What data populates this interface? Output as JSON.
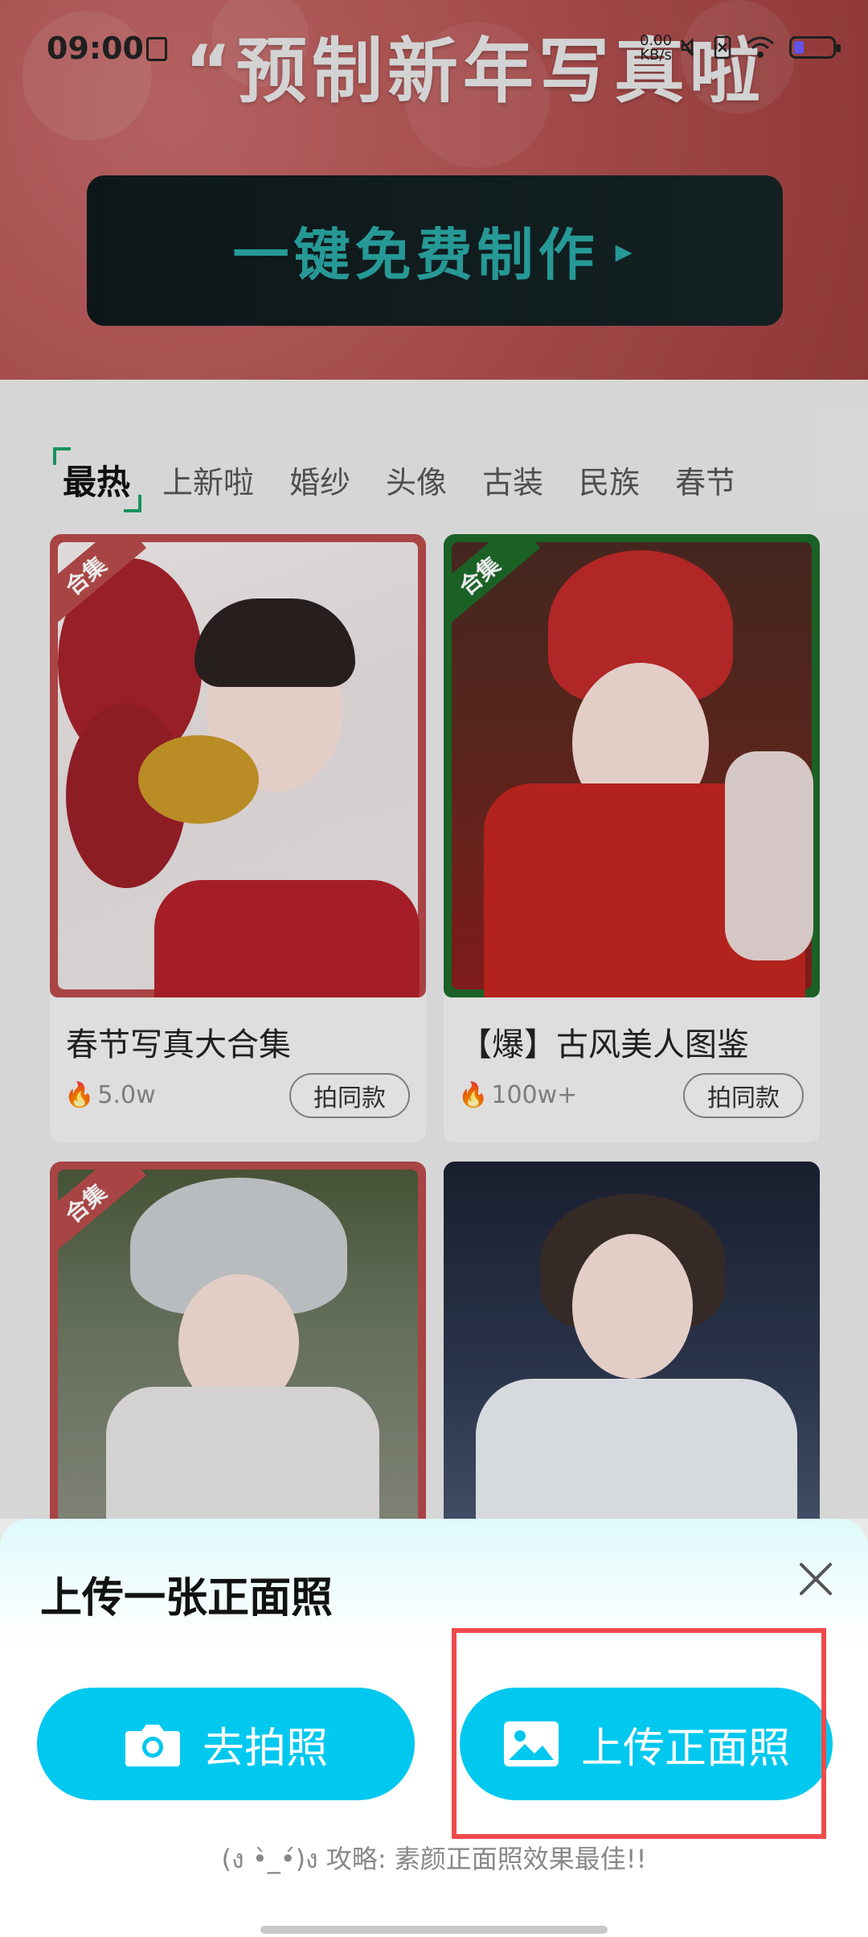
{
  "status_bar": {
    "time": "09:00",
    "speed_value": "0.00",
    "speed_unit": "KB/s"
  },
  "banner": {
    "title": "“预制新年写真啦",
    "cta_label": "一键免费制作",
    "cta_arrow": "▸"
  },
  "tabs": [
    "最热",
    "上新啦",
    "婚纱",
    "头像",
    "古装",
    "民族",
    "春节"
  ],
  "cards": [
    {
      "tag": "合集",
      "title": "春节写真大合集",
      "count": "5.0w",
      "action": "拍同款",
      "accent": "#b84a4a"
    },
    {
      "tag": "合集",
      "title": "【爆】古风美人图鉴",
      "count": "100w+",
      "action": "拍同款",
      "accent": "#1e6a2a"
    },
    {
      "tag": "合集",
      "title": "",
      "count": "",
      "action": "",
      "accent": "#b84a4a"
    },
    {
      "tag": "",
      "title": "",
      "count": "",
      "action": "",
      "accent": "#2a3346"
    }
  ],
  "sheet": {
    "title": "上传一张正面照",
    "take_photo": "去拍照",
    "upload_photo": "上传正面照",
    "tip": "(ง •̀_•́)ง 攻略: 素颜正面照效果最佳!!"
  }
}
